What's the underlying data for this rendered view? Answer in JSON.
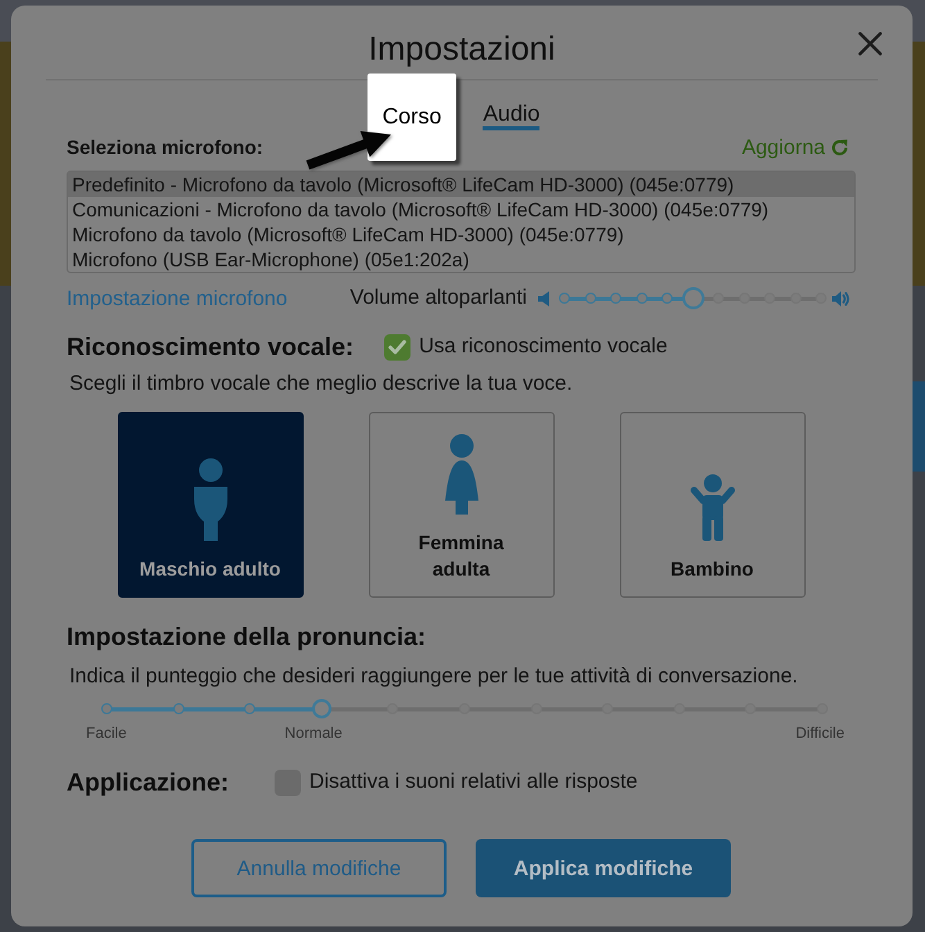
{
  "window": {
    "title": "Impostazioni"
  },
  "tabs": [
    {
      "label": "Corso",
      "selected": false,
      "highlighted": true
    },
    {
      "label": "Audio",
      "selected": true,
      "highlighted": false
    }
  ],
  "microphone": {
    "label": "Seleziona microfono:",
    "refresh": "Aggiorna",
    "devices": [
      {
        "name": "Predefinito - Microfono da tavolo (Microsoft® LifeCam HD-3000) (045e:0779)",
        "selected": true
      },
      {
        "name": "Comunicazioni - Microfono da tavolo (Microsoft® LifeCam HD-3000) (045e:0779)",
        "selected": false
      },
      {
        "name": "Microfono da tavolo (Microsoft® LifeCam HD-3000) (045e:0779)",
        "selected": false
      },
      {
        "name": "Microfono (USB Ear-Microphone) (05e1:202a)",
        "selected": false
      }
    ]
  },
  "audio": {
    "mic_settings_link": "Impostazione microfono",
    "volume": {
      "label": "Volume altoparlanti",
      "level": 0.5
    }
  },
  "voice_recognition": {
    "heading": "Riconoscimento vocale:",
    "toggle": {
      "label": "Usa riconoscimento vocale",
      "checked": true
    },
    "hint": "Scegli il timbro vocale che meglio descrive la tua voce.",
    "options": [
      {
        "kind": "man",
        "label": "Maschio adulto",
        "selected": true
      },
      {
        "kind": "woman",
        "label": "Femmina adulta",
        "selected": false
      },
      {
        "kind": "child",
        "label": "Bambino",
        "selected": false
      }
    ]
  },
  "pronunciation": {
    "heading": "Impostazione della pronuncia:",
    "hint": "Indica il punteggio che desideri raggiungere per le tue attività di conversazione.",
    "level": 0.3,
    "labels": [
      "Facile",
      "Normale",
      "Difficile"
    ]
  },
  "application": {
    "heading": "Applicazione:",
    "toggle": {
      "label": "Disattiva i suoni relativi alle risposte",
      "checked": false
    }
  },
  "buttons": [
    {
      "kind": "secondary",
      "label": "Annulla modifiche"
    },
    {
      "kind": "primary",
      "label": "Applica modifiche"
    }
  ]
}
